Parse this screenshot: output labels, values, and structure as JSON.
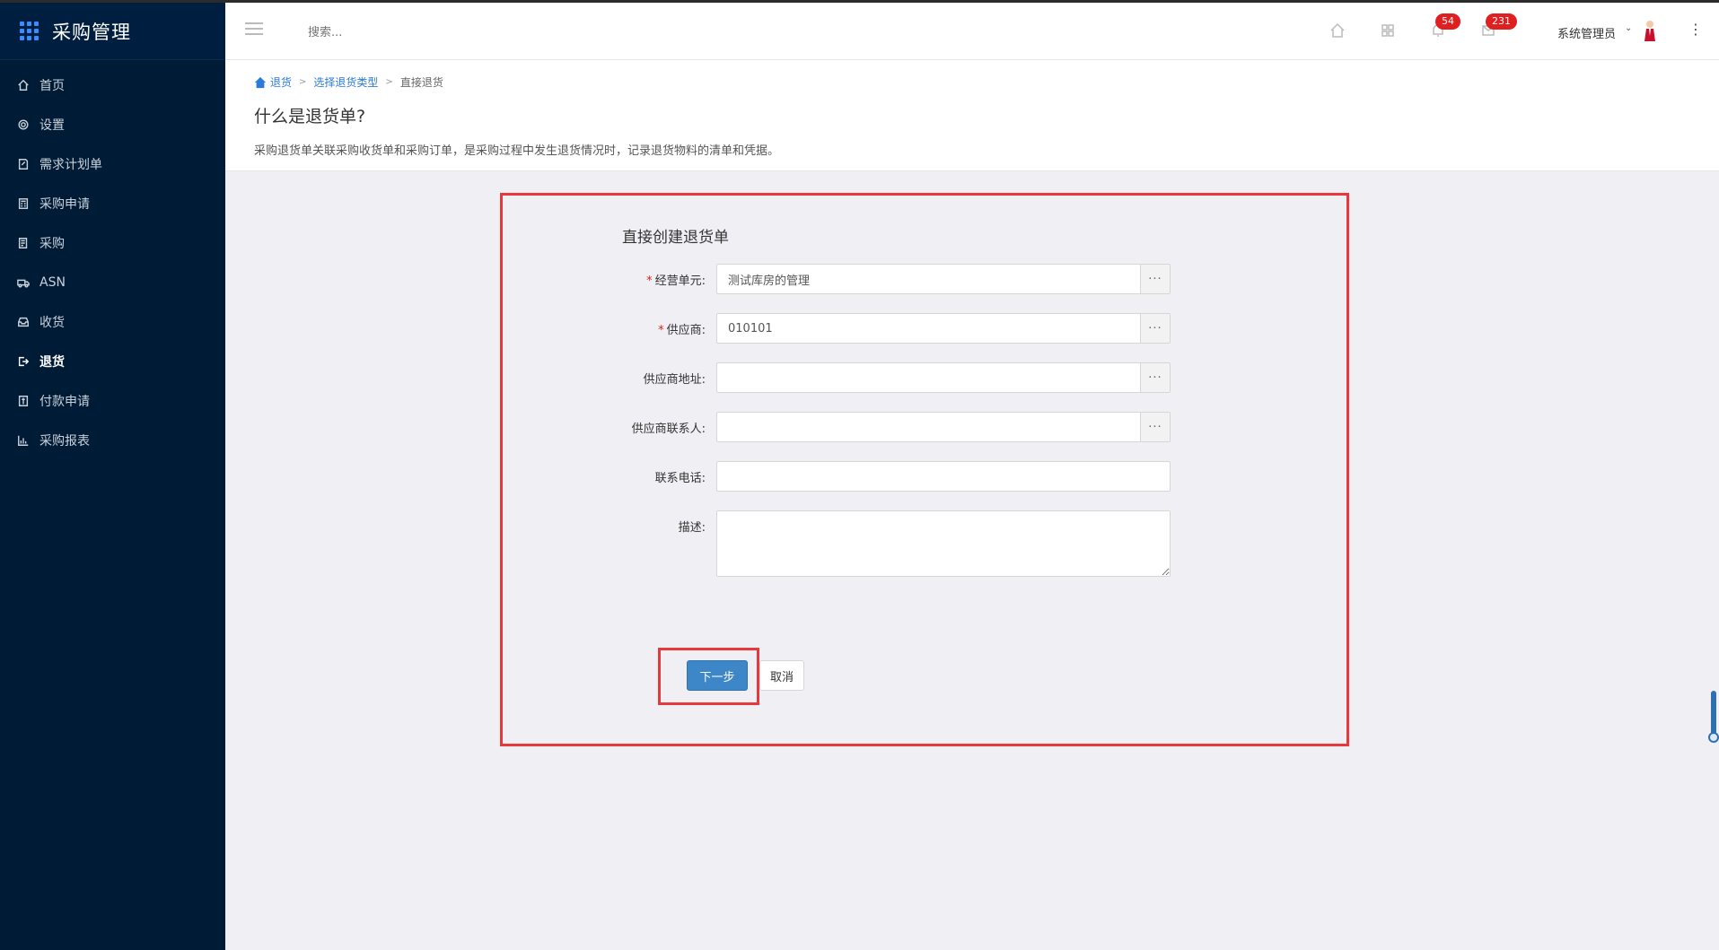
{
  "app": {
    "title": "采购管理"
  },
  "sidebar": {
    "items": [
      {
        "label": "首页",
        "icon": "home-icon"
      },
      {
        "label": "设置",
        "icon": "gear-icon"
      },
      {
        "label": "需求计划单",
        "icon": "document-edit-icon"
      },
      {
        "label": "采购申请",
        "icon": "calculator-icon"
      },
      {
        "label": "采购",
        "icon": "list-document-icon"
      },
      {
        "label": "ASN",
        "icon": "truck-icon"
      },
      {
        "label": "收货",
        "icon": "inbox-icon"
      },
      {
        "label": "退货",
        "icon": "sign-out-icon",
        "active": true
      },
      {
        "label": "付款申请",
        "icon": "invoice-icon"
      },
      {
        "label": "采购报表",
        "icon": "bar-chart-icon"
      }
    ]
  },
  "header": {
    "search_placeholder": "搜索...",
    "notifications_count": "54",
    "messages_count": "231",
    "user_name": "系统管理员"
  },
  "breadcrumb": {
    "items": [
      "退货",
      "选择退货类型"
    ],
    "current": "直接退货",
    "separator": ">"
  },
  "page": {
    "title": "什么是退货单?",
    "description": "采购退货单关联采购收货单和采购订单，是采购过程中发生退货情况时，记录退货物料的清单和凭据。"
  },
  "form": {
    "title": "直接创建退货单",
    "fields": {
      "business_unit": {
        "label": "经营单元:",
        "required": true,
        "value": "测试库房的管理"
      },
      "supplier": {
        "label": "供应商:",
        "required": true,
        "value": "010101"
      },
      "supplier_address": {
        "label": "供应商地址:",
        "required": false,
        "value": ""
      },
      "supplier_contact": {
        "label": "供应商联系人:",
        "required": false,
        "value": ""
      },
      "phone": {
        "label": "联系电话:",
        "required": false,
        "value": ""
      },
      "description": {
        "label": "描述:",
        "required": false,
        "value": ""
      }
    },
    "picker_label": "···",
    "required_mark": "*",
    "next_label": "下一步",
    "cancel_label": "取消"
  },
  "colors": {
    "sidebar_bg": "#001b35",
    "accent": "#3d86c8",
    "highlight": "#e8383d",
    "badge": "#e02020"
  }
}
